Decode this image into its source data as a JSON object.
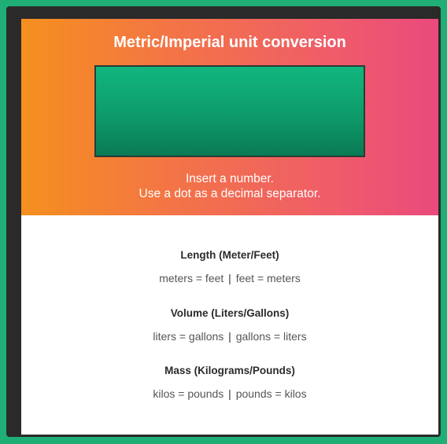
{
  "header": {
    "title": "Metric/Imperial unit conversion",
    "input": {
      "value": "",
      "placeholder": ""
    },
    "hint_line1": "Insert a number.",
    "hint_line2": "Use a dot as a decimal separator."
  },
  "conversions": [
    {
      "title": "Length (Meter/Feet)",
      "left": "meters = feet",
      "separator": "|",
      "right": "feet = meters"
    },
    {
      "title": "Volume (Liters/Gallons)",
      "left": "liters = gallons",
      "separator": "|",
      "right": "gallons = liters"
    },
    {
      "title": "Mass (Kilograms/Pounds)",
      "left": "kilos = pounds",
      "separator": "|",
      "right": "pounds = kilos"
    }
  ],
  "colors": {
    "background": "#1fae76",
    "frame": "#2a2a2a",
    "gradient_start": "#f5901e",
    "gradient_end": "#ea4a7c",
    "input_green": "#0e9b6b"
  }
}
